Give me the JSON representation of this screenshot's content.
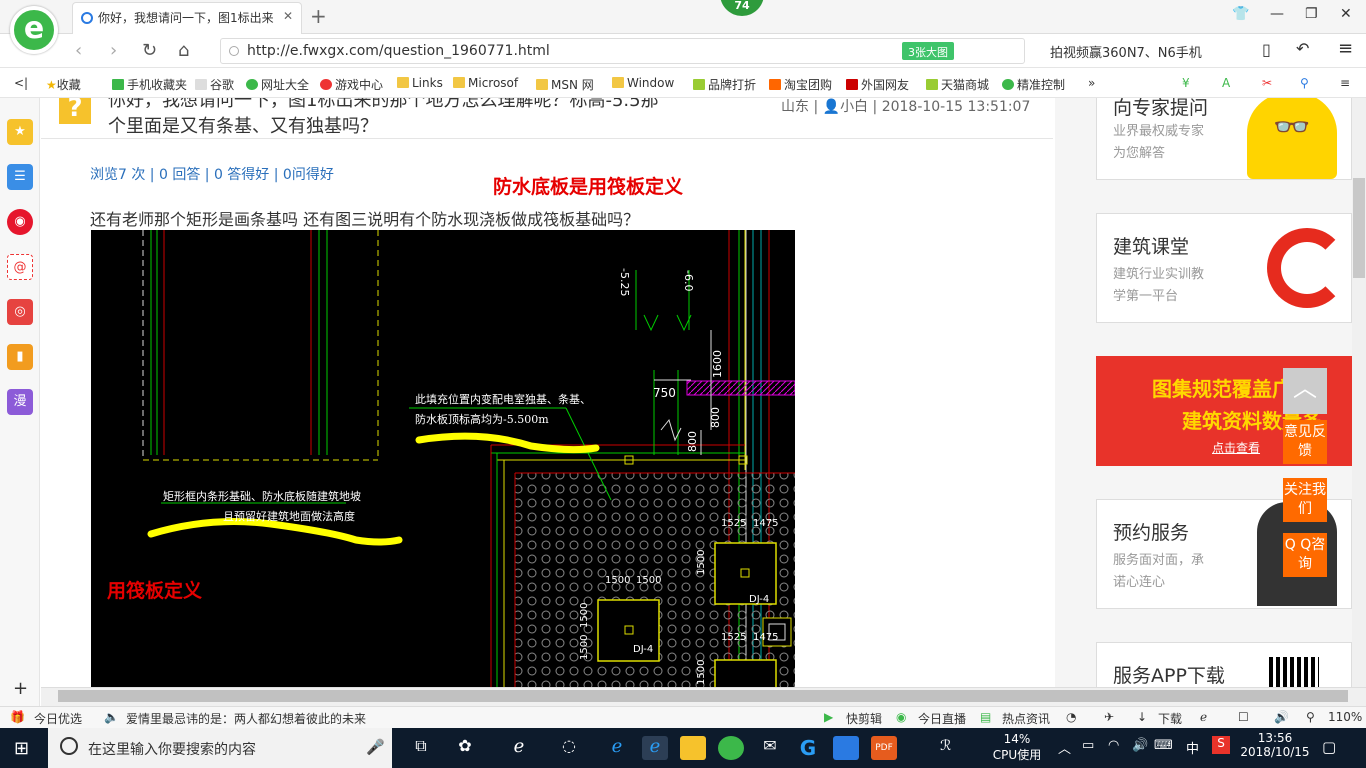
{
  "browser": {
    "tab_title": "你好，我想请问一下，图1标出来",
    "badge": "74",
    "url": "http://e.fwxgx.com/question_1960771.html",
    "big_image_label": "3张大图",
    "search_prompt": "拍视频赢360N7、N6手机"
  },
  "bookmarks": [
    "收藏",
    "手机收藏夹",
    "谷歌",
    "网址大全",
    "游戏中心",
    "Links",
    "Microsof",
    "MSN 网",
    "Window",
    "品牌打折",
    "淘宝团购",
    "外国网友",
    "天猫商城",
    "精准控制"
  ],
  "question": {
    "title_line1": "你好，我想请问一下，图1标出来的那个地方怎么理解呢？标高-5.5那",
    "title_line2": "个里面是又有条基、又有独基吗？",
    "location": "山东",
    "author": "小白",
    "datetime": "2018-10-15 13:51:07",
    "stats": "浏览7 次 | 0 回答 | 0 答得好 | 0问得好",
    "annotation_top": "防水底板是用筏板定义",
    "body": "还有老师那个矩形是画条基吗  还有图三说明有个防水现浇板做成筏板基础吗？"
  },
  "drawing": {
    "label_5_25": "-5.25",
    "label_6_0": "-6.0",
    "dim_1600": "1600",
    "dim_750": "750",
    "dim_800a": "800",
    "dim_800b": "800",
    "note1_line1": "此填充位置内变配电室独基、条基、",
    "note1_line2": "防水板顶标高均为-5.500m",
    "note2_line1": "矩形框内条形基础、防水底板随建筑地坡",
    "note2_line2": "且预留好建筑地面做法高度",
    "red_label": "用筏板定义",
    "dim_1525a": "1525",
    "dim_1475a": "1475",
    "dim_1525b": "1525",
    "dim_1475b": "1475",
    "dim_1500a": "1500",
    "dim_1500b": "1500",
    "dim_1500c": "1500",
    "dim_1500d": "1500",
    "dim_1500e": "1500",
    "dim_1500f": "1500",
    "dj4a": "DJ-4",
    "dj4b": "DJ-4"
  },
  "sidebar_cards": [
    {
      "title": "向专家提问",
      "desc1": "业界最权威专家",
      "desc2": "为您解答"
    },
    {
      "title": "建筑课堂",
      "desc1": "建筑行业实训教",
      "desc2": "学第一平台"
    },
    {
      "banner1": "图集规范覆盖广",
      "banner2": "建筑资料数量多",
      "banner_btn": "点击查看"
    },
    {
      "title": "预约服务",
      "desc1": "服务面对面，承",
      "desc2": "诺心连心"
    },
    {
      "title": "服务APP下载"
    }
  ],
  "float_buttons": [
    "意见反馈",
    "关注我们",
    "Q Q咨询"
  ],
  "statusbar": {
    "today": "今日优选",
    "headline": "爱情里最忌讳的是：两人都幻想着彼此的未来",
    "kuaijian": "快剪辑",
    "live": "今日直播",
    "news": "热点资讯",
    "download": "下载",
    "zoom": "110%"
  },
  "taskbar": {
    "search_placeholder": "在这里输入你要搜索的内容",
    "cpu_pct": "14%",
    "cpu_label": "CPU使用",
    "ime": "中",
    "time": "13:56",
    "date": "2018/10/15"
  }
}
